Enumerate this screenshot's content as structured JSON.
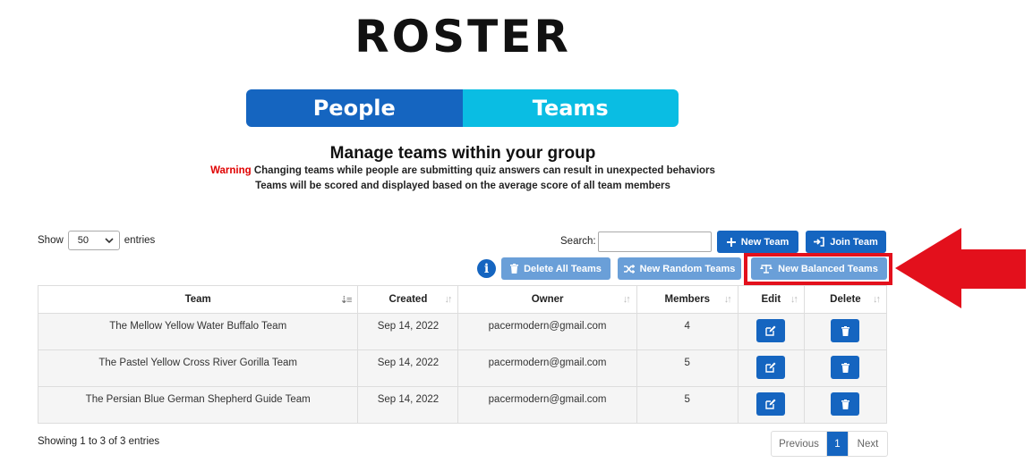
{
  "logo": {
    "text": "ROSTER"
  },
  "tabs": [
    {
      "label": "People"
    },
    {
      "label": "Teams"
    }
  ],
  "intro": {
    "title": "Manage teams within your group",
    "warning_label": "Warning",
    "warning_text": " Changing teams while people are submitting quiz answers can result in unexpected behaviors",
    "note": "Teams will be scored and displayed based on the average score of all team members"
  },
  "controls": {
    "show_label": "Show",
    "entries_value": "50",
    "entries_label": "entries",
    "search_label": "Search:",
    "search_value": "",
    "new_team": "New Team",
    "join_team": "Join Team",
    "delete_all_teams": "Delete All Teams",
    "new_random_teams": "New Random Teams",
    "new_balanced_teams": "New Balanced Teams"
  },
  "table": {
    "columns": [
      "Team",
      "Created",
      "Owner",
      "Members",
      "Edit",
      "Delete"
    ],
    "rows": [
      {
        "team": "The Mellow Yellow Water Buffalo Team",
        "created": "Sep 14, 2022",
        "owner": "pacermodern@gmail.com",
        "members": "4"
      },
      {
        "team": "The Pastel Yellow Cross River Gorilla Team",
        "created": "Sep 14, 2022",
        "owner": "pacermodern@gmail.com",
        "members": "5"
      },
      {
        "team": "The Persian Blue German Shepherd Guide Team",
        "created": "Sep 14, 2022",
        "owner": "pacermodern@gmail.com",
        "members": "5"
      }
    ]
  },
  "footer": {
    "info": "Showing 1 to 3 of 3 entries",
    "previous": "Previous",
    "page": "1",
    "next": "Next"
  },
  "colors": {
    "primary": "#1565c0",
    "primary_light": "#6a9fd8",
    "teams_tab": "#0abde3",
    "warning": "#e00000",
    "annotation": "#e3101c"
  }
}
